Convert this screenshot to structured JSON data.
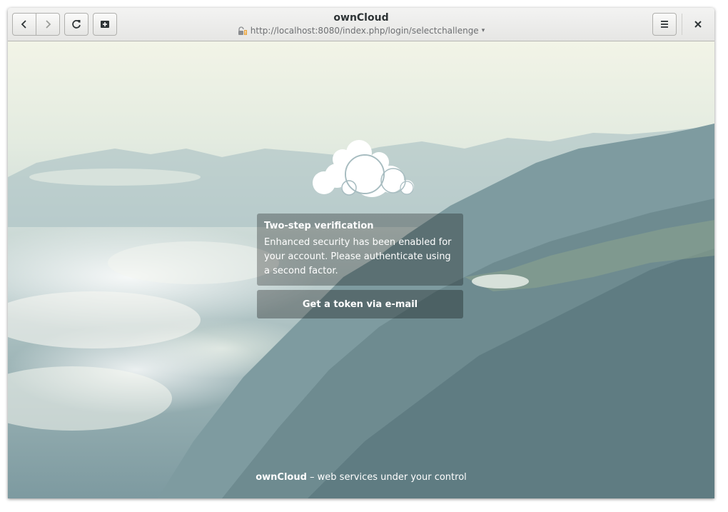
{
  "window": {
    "title": "ownCloud",
    "url": "http://localhost:8080/index.php/login/selectchallenge",
    "url_dropdown_glyph": "▾"
  },
  "toolbar": {
    "back_icon": "chevron-left-icon",
    "forward_icon": "chevron-right-icon",
    "reload_icon": "reload-icon",
    "new_tab_icon": "new-tab-icon",
    "menu_icon": "hamburger-menu-icon",
    "close_icon": "close-icon"
  },
  "page": {
    "card_title": "Two-step verification",
    "card_text": "Enhanced security has been enabled for your account. Please authenticate using a second factor.",
    "token_button_label": "Get a token via e-mail",
    "footer_brand": "ownCloud",
    "footer_rest": " – web services under your control"
  },
  "colors": {
    "card_background": "rgba(0,0,0,0.28)",
    "text": "#ffffff",
    "header_background": "#e8e8e7"
  }
}
